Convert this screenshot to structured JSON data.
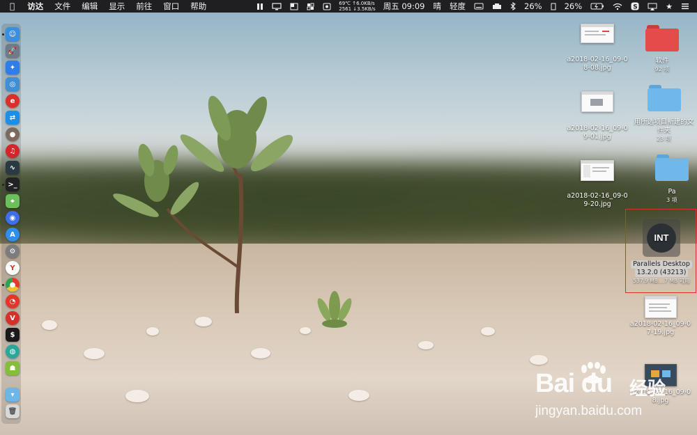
{
  "menubar": {
    "app_name": "访达",
    "menus": [
      "文件",
      "编辑",
      "显示",
      "前往",
      "窗口",
      "帮助"
    ],
    "status": {
      "temperature": "69℃",
      "net_up": "↑6.0KB/s",
      "fan": "2561",
      "net_down": "↓3.5KB/s",
      "clock": "周五 09:09",
      "weather": "晴",
      "weather_level": "轻度",
      "cpu_percent": "26%",
      "battery_percent": "26%"
    }
  },
  "dock": {
    "icons": [
      {
        "name": "finder",
        "color": "#3a8fe0"
      },
      {
        "name": "launchpad",
        "color": "#6d7b8a"
      },
      {
        "name": "safari",
        "color": "#2f7ee8"
      },
      {
        "name": "preview",
        "color": "#3f8fd6"
      },
      {
        "name": "app-red",
        "color": "#d8312b"
      },
      {
        "name": "teamviewer",
        "color": "#1d8ee5"
      },
      {
        "name": "ball-app",
        "color": "#7c6b5c"
      },
      {
        "name": "netease",
        "color": "#d2262a"
      },
      {
        "name": "activity-monitor",
        "color": "#2b3a40"
      },
      {
        "name": "terminal",
        "color": "#222222"
      },
      {
        "name": "maps",
        "color": "#6cbf5a"
      },
      {
        "name": "siri",
        "color": "#3e6ee8"
      },
      {
        "name": "app-store",
        "color": "#2f8ff0"
      },
      {
        "name": "system-preferences",
        "color": "#7c7c7c"
      },
      {
        "name": "yandex",
        "color": "#e23226"
      },
      {
        "name": "chrome",
        "color": "#e3a52a"
      },
      {
        "name": "weibo",
        "color": "#e2362a"
      },
      {
        "name": "vivaldi",
        "color": "#d5312c"
      },
      {
        "name": "terminal-2",
        "color": "#1a1a1a"
      },
      {
        "name": "app-teal",
        "color": "#2ba79a"
      },
      {
        "name": "android",
        "color": "#86bd3b"
      },
      {
        "name": "downloads-folder",
        "color": "#6cb7ea"
      },
      {
        "name": "trash",
        "color": "#c9c9c9"
      }
    ]
  },
  "desktop": {
    "files": [
      {
        "name": "a2018-02-16_09-08-08.jpg",
        "line1": "a2018-02-16_09-0",
        "line2": "8-08.jpg"
      },
      {
        "name": "a2018-02-16_09-09-01.jpg",
        "line1": "a2018-02-16_09-0",
        "line2": "9-01.jpg"
      },
      {
        "name": "a2018-02-16_09-09-20.jpg",
        "line1": "a2018-02-16_09-0",
        "line2": "9-20.jpg"
      },
      {
        "name": "a2018-02-16_09-07-19.jpg",
        "line1": "a2018-02-16_09-0",
        "line2": "7-19.jpg"
      },
      {
        "name": "a2018-02-16_09-08.jpg",
        "line1": "a2018-02-16_09-0",
        "line2": "8.jpg"
      }
    ],
    "folders": [
      {
        "name": "软件",
        "count": "92 项",
        "color": "#e44b4b"
      },
      {
        "name_line1": "用所选项目新建的文",
        "name_line2": "件夹",
        "count": "23 项",
        "color": "#6fb8ec"
      },
      {
        "name": "Pa",
        "count": "3 项",
        "color": "#6fb8ec"
      }
    ],
    "volume": {
      "name_line1": "Parallels Desktop",
      "name_line2": "13.2.0 (43213)",
      "info": "537.9 MB....7 MB 可用",
      "logo_text": "INT"
    }
  },
  "watermark": {
    "brand": "Bai du",
    "cn": "经验",
    "url": "jingyan.baidu.com"
  }
}
